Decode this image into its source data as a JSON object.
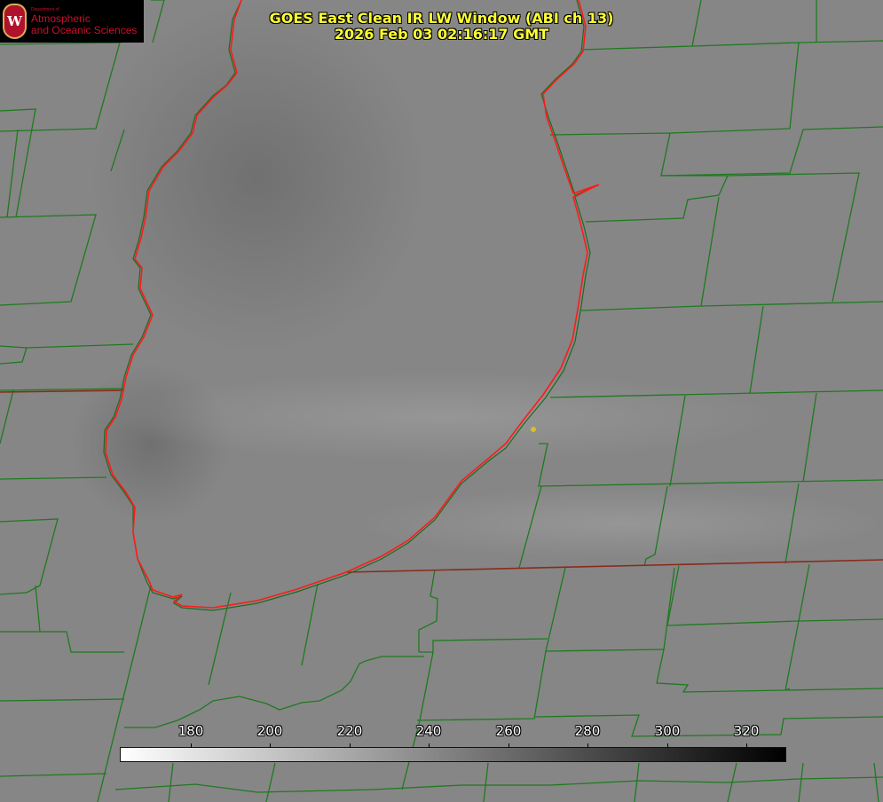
{
  "title": {
    "line1": "GOES East Clean IR LW Window (ABI ch 13)",
    "line2": "2026 Feb 03 02:16:17 GMT"
  },
  "logo": {
    "department": "Department of",
    "line1": "Atmospheric",
    "line2": "and Oceanic Sciences",
    "seal_letter": "W"
  },
  "colorbar": {
    "ticks": [
      "180",
      "200",
      "220",
      "240",
      "260",
      "280",
      "300",
      "320"
    ],
    "colors": {
      "start": "#ffffff",
      "end": "#000000"
    }
  },
  "colors": {
    "county_lines": "#1f7a1f",
    "coastline": "#ff2020",
    "title_text": "#ffff33",
    "marker": "#d8c020"
  },
  "icons": [
    "uw-crest-icon",
    "location-dot-icon"
  ]
}
